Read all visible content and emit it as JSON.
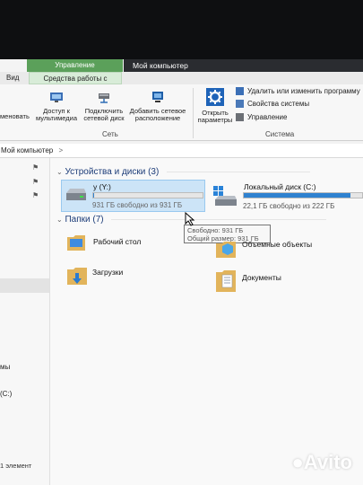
{
  "ribbon_tabs": {
    "view": "Вид",
    "manage": "Управление",
    "drive_tools": "Средства работы с дисками",
    "window_title": "Мой компьютер"
  },
  "ribbon": {
    "rename_partial": "меновать",
    "media_access": "Доступ к\nмультимедиа",
    "map_drive": "Подключить\nсетевой диск",
    "add_network": "Добавить сетевое\nрасположение",
    "open_params": "Открыть\nпараметры",
    "uninstall": "Удалить или изменить программу",
    "system_props": "Свойства системы",
    "manage": "Управление",
    "group_network": "Сеть",
    "group_system": "Система"
  },
  "address": {
    "path": "Мой компьютер",
    "chevron": ">"
  },
  "nav": {
    "item_partial1": "мы",
    "item_partial2": "(C:)"
  },
  "devices": {
    "header": "Устройства и диски (3)",
    "drives": [
      {
        "name": "y (Y:)",
        "free_text": "931 ГБ свободно из 931 ГБ",
        "used_fraction": 0.001
      },
      {
        "name": "Локальный диск (C:)",
        "free_text": "22,1 ГБ свободно из 222 ГБ",
        "used_fraction": 0.9
      }
    ]
  },
  "tooltip": {
    "line1": "Свободно: 931 ГБ",
    "line2": "Общий размер: 931 ГБ"
  },
  "folders": {
    "header": "Папки (7)",
    "items": [
      {
        "name": "Рабочий стол"
      },
      {
        "name": "Объемные объекты"
      },
      {
        "name": "Загрузки"
      },
      {
        "name": "Документы"
      }
    ]
  },
  "status": {
    "text": "1 элемент"
  },
  "watermark": {
    "text": "Avito"
  },
  "colors": {
    "accent": "#2f82d0",
    "green_tab": "#5ba05a",
    "selection": "#cce4f7"
  }
}
